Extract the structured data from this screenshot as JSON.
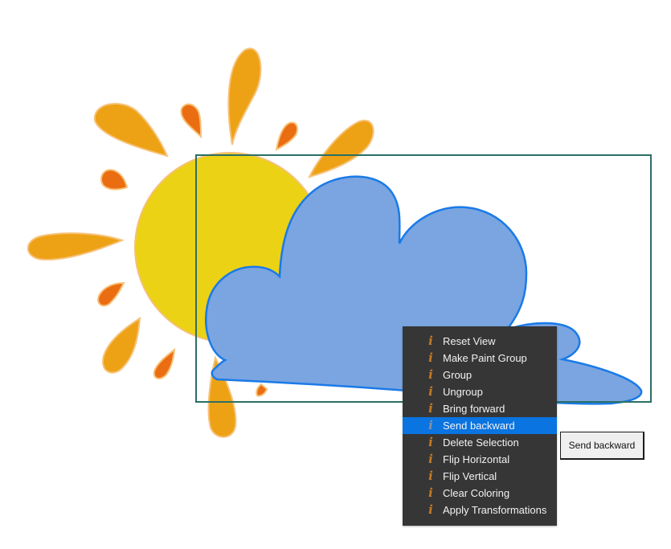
{
  "canvas": {
    "artwork": [
      {
        "name": "sun",
        "fill": "#ebd214",
        "stroke": "#f5c07a"
      },
      {
        "name": "sun-ray-large",
        "fill": "#eda215",
        "stroke": "#f7c27a"
      },
      {
        "name": "sun-ray-small",
        "fill": "#eb6d12",
        "stroke": "#f7c27a"
      },
      {
        "name": "cloud",
        "fill": "#7aa5e0",
        "stroke": "#1a7ae8"
      }
    ],
    "selection_color": "#2a6f66"
  },
  "context_menu": {
    "items": [
      {
        "label": "Reset View",
        "icon": "info-icon",
        "active": false
      },
      {
        "label": "Make Paint Group",
        "icon": "info-icon",
        "active": false
      },
      {
        "label": "Group",
        "icon": "info-icon",
        "active": false
      },
      {
        "label": "Ungroup",
        "icon": "info-icon",
        "active": false
      },
      {
        "label": "Bring forward",
        "icon": "info-icon",
        "active": false
      },
      {
        "label": "Send backward",
        "icon": "info-icon",
        "active": true
      },
      {
        "label": "Delete Selection",
        "icon": "info-icon",
        "active": false
      },
      {
        "label": "Flip Horizontal",
        "icon": "info-icon",
        "active": false
      },
      {
        "label": "Flip Vertical",
        "icon": "info-icon",
        "active": false
      },
      {
        "label": "Clear Coloring",
        "icon": "info-icon",
        "active": false
      },
      {
        "label": "Apply Transformations",
        "icon": "info-icon",
        "active": false
      }
    ],
    "icon_glyph": "i",
    "background": "#363636",
    "highlight": "#0a74e0"
  },
  "tooltip": {
    "text": "Send backward"
  }
}
